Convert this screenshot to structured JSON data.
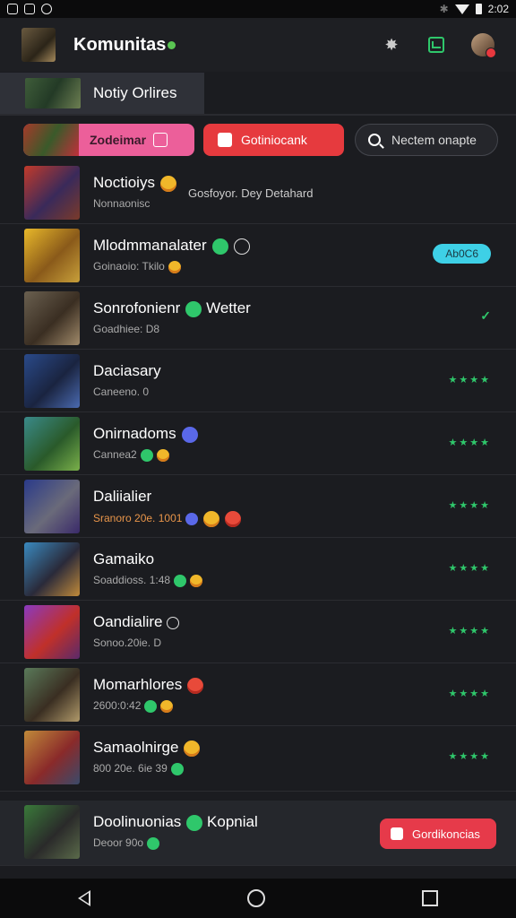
{
  "status_bar": {
    "time": "2:02"
  },
  "app_bar": {
    "title": "Komunitas"
  },
  "section_tab": {
    "label": "Notiy Orlires"
  },
  "chips": [
    {
      "label": "Zodeimar"
    },
    {
      "label": "Gotiniocank"
    },
    {
      "label": "Nectem onapte"
    }
  ],
  "rows": [
    {
      "name": "Noctioiys",
      "sub": "Nonnaonisc",
      "note": "Gosfoyor. Dey Detahard"
    },
    {
      "name": "Mlodmmanalater",
      "sub": "Goinaoio: Tkilo",
      "right": "Ab0C6"
    },
    {
      "name": "Sonrofonienr",
      "name_suffix": "Wetter",
      "sub": "Goadhiee: D8"
    },
    {
      "name": "Daciasary",
      "sub": "Caneeno. 0"
    },
    {
      "name": "Onirnadoms",
      "sub": "Cannea2"
    },
    {
      "name": "Daliialier",
      "sub": "Sranoro 20e. 1001"
    },
    {
      "name": "Gamaiko",
      "sub": "Soaddioss. 1:48"
    },
    {
      "name": "Oandialire",
      "sub": "Sonoo.20ie. D"
    },
    {
      "name": "Momarhlores",
      "sub": "2600:0:42"
    },
    {
      "name": "Samaolnirge",
      "sub": "800 20e.  6ie 39"
    }
  ],
  "bottom_row": {
    "name": "Doolinuonias",
    "name_suffix": "Kopnial",
    "sub": "Deoor 90o",
    "button": "Gordikoncias"
  },
  "colors": {
    "accent_green": "#2fc76b",
    "accent_red": "#e63a3e",
    "accent_pink": "#ec5f9a",
    "accent_cyan": "#3ed0e6",
    "background": "#1b1c20"
  }
}
